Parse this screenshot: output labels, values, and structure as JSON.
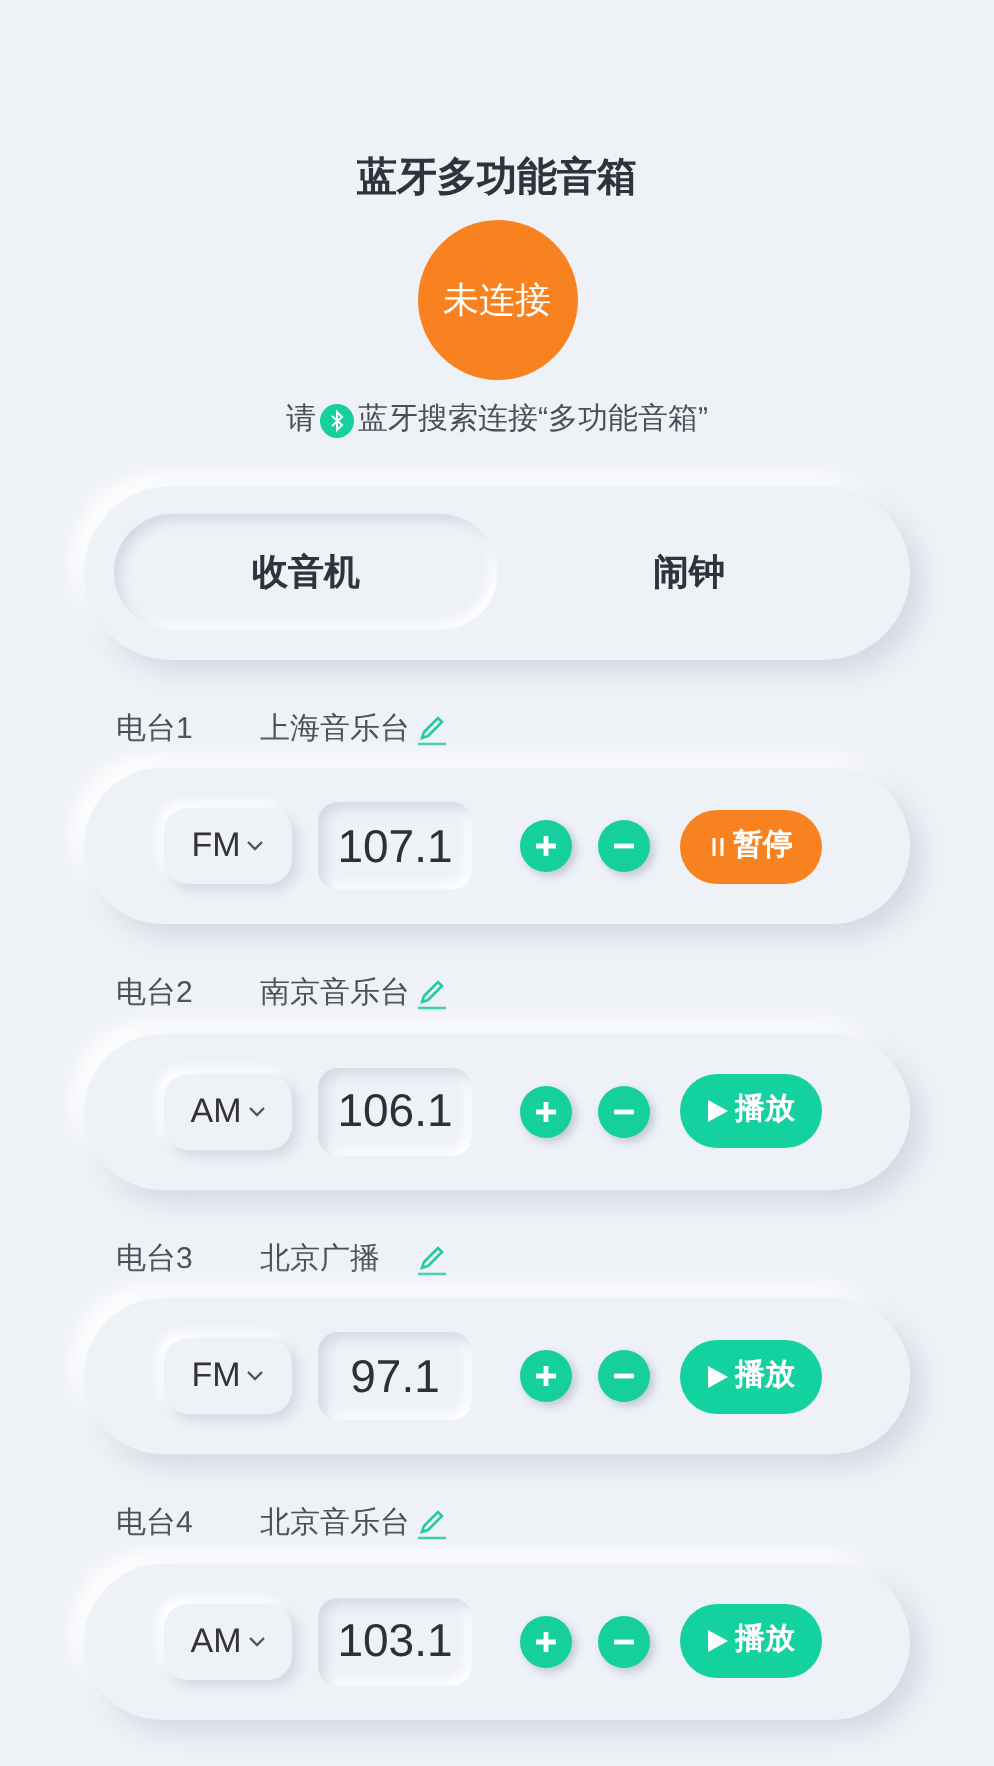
{
  "title": "蓝牙多功能音箱",
  "status": {
    "label": "未连接",
    "connected": false
  },
  "hint": {
    "before": "请",
    "after": "蓝牙搜索连接“多功能音箱”"
  },
  "tabs": [
    {
      "label": "收音机",
      "selected": true
    },
    {
      "label": "闹钟",
      "selected": false
    }
  ],
  "stations": [
    {
      "label": "电台1",
      "name": "上海音乐台",
      "band": "FM",
      "frequency": "107.1",
      "playing": true,
      "button": "暂停"
    },
    {
      "label": "电台2",
      "name": "南京音乐台",
      "band": "AM",
      "frequency": "106.1",
      "playing": false,
      "button": "播放"
    },
    {
      "label": "电台3",
      "name": "北京广播",
      "band": "FM",
      "frequency": "97.1",
      "playing": false,
      "button": "播放"
    },
    {
      "label": "电台4",
      "name": "北京音乐台",
      "band": "AM",
      "frequency": "103.1",
      "playing": false,
      "button": "播放"
    }
  ]
}
